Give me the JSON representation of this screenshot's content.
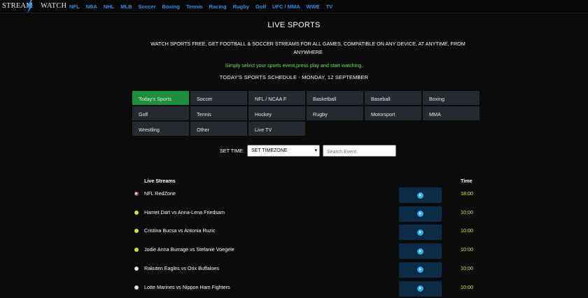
{
  "brand": {
    "name": "STREAM WATCH",
    "name_left": "STREAM",
    "name_right": "WATCH",
    "accent_color": "#2f8fe0"
  },
  "nav": [
    "NFL",
    "NBA",
    "NHL",
    "MLB",
    "Soccer",
    "Boxing",
    "Tennis",
    "Racing",
    "Rugby",
    "Golf",
    "UFC / MMA",
    "WWE",
    "TV"
  ],
  "page": {
    "title": "LIVE SPORTS",
    "intro": "WATCH SPORTS FREE, GET FOOTBALL & SOCCER STREAMS FOR ALL GAMES, COMPATIBLE ON ANY DEVICE, AT ANYTIME, FROM ANYWHERE",
    "tagline": "Simply select your sports event,press play and start watching.",
    "tagline_color": "#6ee05a",
    "schedule": "TODAY'S SPORTS SCHEDULE - MONDAY, 12 SEPTEMBER"
  },
  "categories": [
    {
      "label": "Today's Sports",
      "active": true
    },
    {
      "label": "Soccer",
      "active": false
    },
    {
      "label": "NFL / NCAA F",
      "active": false
    },
    {
      "label": "Basketball",
      "active": false
    },
    {
      "label": "Baseball",
      "active": false
    },
    {
      "label": "Boxing",
      "active": false
    },
    {
      "label": "Golf",
      "active": false
    },
    {
      "label": "Tennis",
      "active": false
    },
    {
      "label": "Hockey",
      "active": false
    },
    {
      "label": "Rugby",
      "active": false
    },
    {
      "label": "Motorsport",
      "active": false
    },
    {
      "label": "MMA",
      "active": false
    },
    {
      "label": "Wrestling",
      "active": false
    },
    {
      "label": "Other",
      "active": false
    },
    {
      "label": "Live TV",
      "active": false
    }
  ],
  "controls": {
    "set_time_label": "SET TIME:",
    "timezone_selected": "SET TIMEZONE",
    "search_placeholder": "Search Event"
  },
  "table": {
    "col_streams": "Live Streams",
    "col_time": "Time",
    "rows": [
      {
        "title": "NFL RedZone",
        "time": "18:00",
        "sport": "football",
        "icon": "football-icon"
      },
      {
        "title": "Harriet Dart vs Anna-Lena Friedsam",
        "time": "10:00",
        "sport": "tennis",
        "icon": "tennis-ball-icon"
      },
      {
        "title": "Cristina Bucsa vs Antonia Ruzic",
        "time": "10:00",
        "sport": "tennis",
        "icon": "tennis-ball-icon"
      },
      {
        "title": "Jodie Anna Burrage vs Stefanie Voegele",
        "time": "10:00",
        "sport": "tennis",
        "icon": "tennis-ball-icon"
      },
      {
        "title": "Rakuten Eagles vs Orix Buffaloes",
        "time": "10:00",
        "sport": "baseball",
        "icon": "baseball-icon"
      },
      {
        "title": "Lotte Marines vs Nippon Ham Fighters",
        "time": "10:00",
        "sport": "baseball",
        "icon": "baseball-icon"
      }
    ]
  },
  "colors": {
    "active_tab": "#1e8e3a",
    "watch_button": "#0d2a47",
    "play_icon": "#36a7e6",
    "time_text": "#e7e33c"
  }
}
